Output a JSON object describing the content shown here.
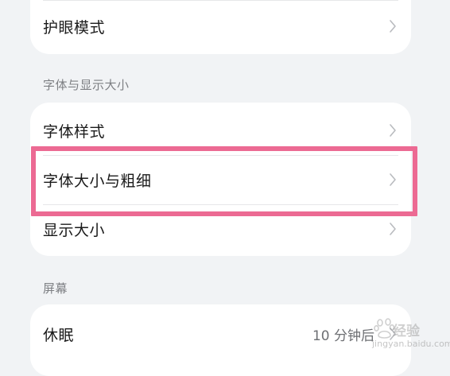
{
  "top_card": {
    "eye_mode_label": "护眼模式"
  },
  "font_section": {
    "header": "字体与显示大小",
    "items": [
      {
        "label": "字体样式"
      },
      {
        "label": "字体大小与粗细"
      },
      {
        "label": "显示大小"
      }
    ]
  },
  "screen_section": {
    "header": "屏幕",
    "sleep_label": "休眠",
    "sleep_value": "10 分钟后"
  },
  "watermark": {
    "brand": "经验",
    "url": "jingyan.baidu.com"
  },
  "colors": {
    "highlight": "#ec6a93",
    "background": "#f1f3f5",
    "card": "#ffffff"
  }
}
